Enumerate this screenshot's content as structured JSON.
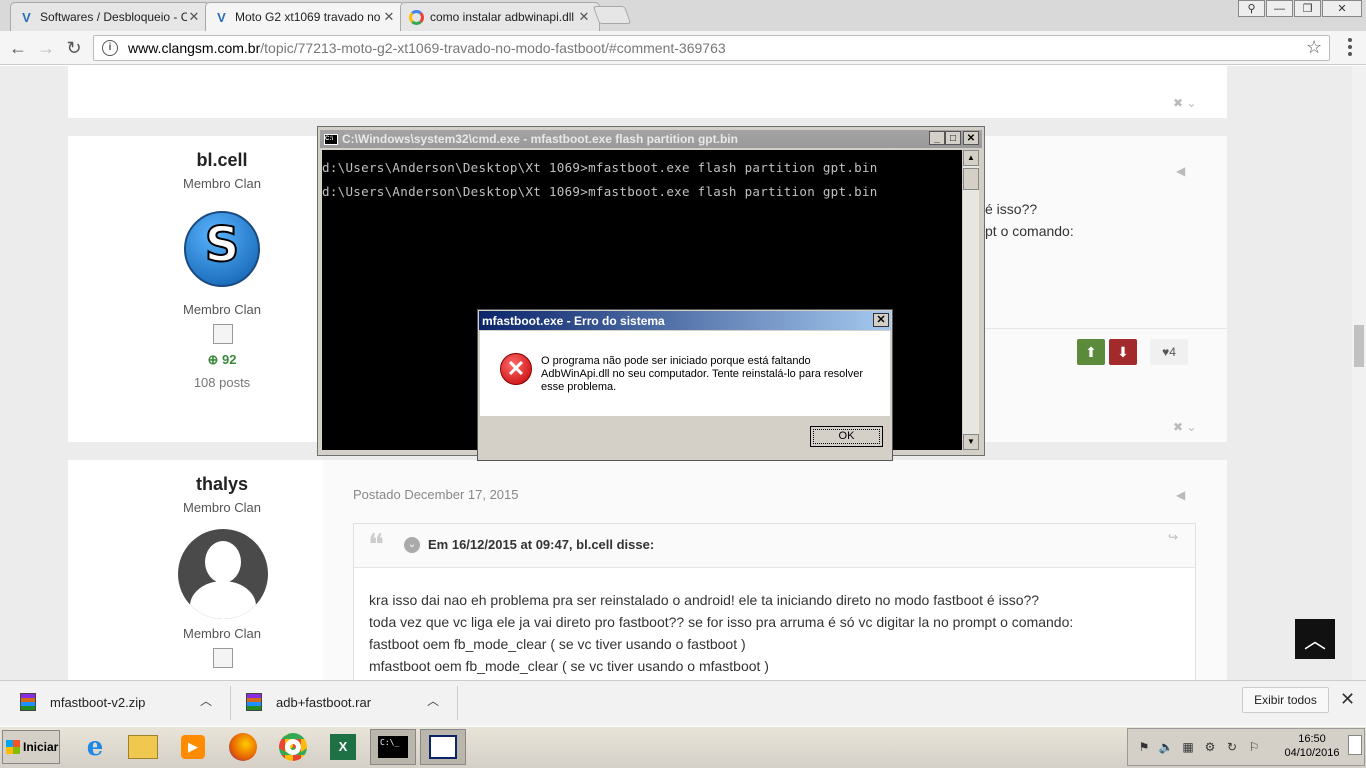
{
  "browser": {
    "tabs": [
      {
        "title": "Softwares / Desbloqueio - C"
      },
      {
        "title": "Moto G2 xt1069 travado no"
      },
      {
        "title": "como instalar adbwinapi.dll"
      }
    ],
    "url_domain": "www.clangsm.com.br",
    "url_path": "/topic/77213-moto-g2-xt1069-travado-no-modo-fastboot/#comment-369763"
  },
  "posts": [
    {
      "author": "bl.cell",
      "group_top": "Membro Clan",
      "group_bottom": "Membro Clan",
      "reputation": "92",
      "post_count": "108 posts",
      "visible_text_1": "é isso??",
      "visible_text_2": "pt o comando:",
      "likes": "4"
    },
    {
      "author": "thalys",
      "group_top": "Membro Clan",
      "group_bottom": "Membro Clan",
      "posted": "Postado December 17, 2015",
      "quote_header": "Em 16/12/2015 at 09:47, bl.cell disse:",
      "lines": [
        "kra isso dai nao eh problema pra ser reinstalado o android! ele ta iniciando direto no modo fastboot é isso??",
        "toda vez que vc liga ele ja vai direto pro fastboot?? se for isso pra arruma é só vc digitar la no prompt o comando:",
        "fastboot oem fb_mode_clear  ( se vc tiver usando o fastboot )",
        "mfastboot oem fb_mode_clear ( se vc tiver usando o mfastboot )"
      ]
    }
  ],
  "cmd": {
    "title": "C:\\Windows\\system32\\cmd.exe - mfastboot.exe  flash partition gpt.bin",
    "lines": [
      "d:\\Users\\Anderson\\Desktop\\Xt 1069>mfastboot.exe flash partition gpt.bin",
      "d:\\Users\\Anderson\\Desktop\\Xt 1069>mfastboot.exe flash partition gpt.bin"
    ]
  },
  "error_dialog": {
    "title": "mfastboot.exe - Erro do sistema",
    "message": "O programa não pode ser iniciado porque está faltando AdbWinApi.dll no seu computador. Tente reinstalá-lo para resolver esse problema.",
    "ok_label": "OK"
  },
  "downloads": {
    "items": [
      {
        "name": "mfastboot-v2.zip"
      },
      {
        "name": "adb+fastboot.rar"
      }
    ],
    "show_all": "Exibir todos"
  },
  "taskbar": {
    "start_label": "Iniciar",
    "time": "16:50",
    "date": "04/10/2016"
  },
  "colors": {
    "upvote": "#5a8a3a",
    "downvote": "#a32a2a",
    "titlebar_active": "#0a246a",
    "rep_green": "#3b8a3b"
  }
}
